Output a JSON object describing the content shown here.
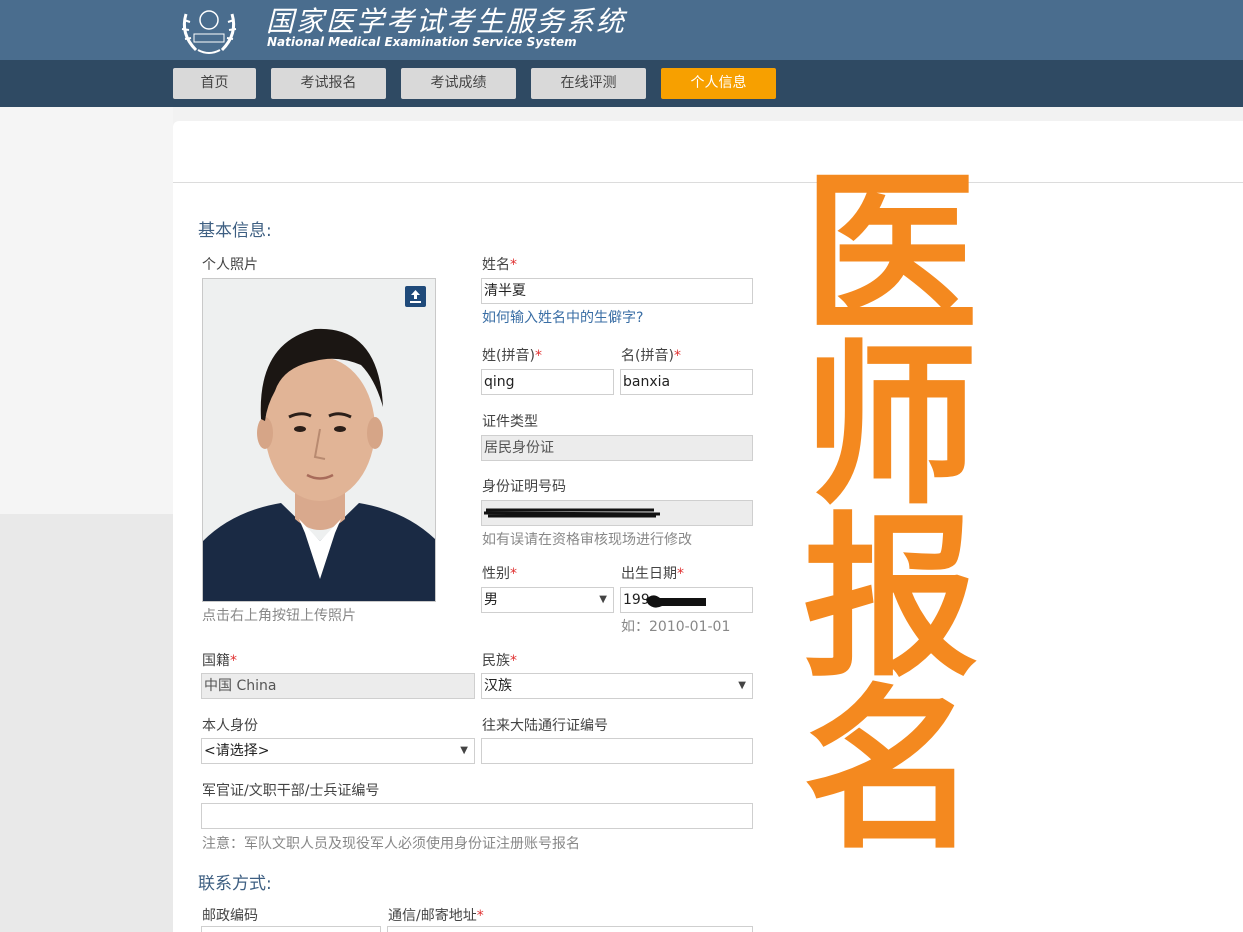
{
  "header": {
    "title_cn": "国家医学考试考生服务系统",
    "title_en": "National Medical Examination Service System"
  },
  "nav": {
    "tabs": [
      "首页",
      "考试报名",
      "考试成绩",
      "在线评测",
      "个人信息"
    ],
    "active_index": 4
  },
  "overlay_text": [
    "医",
    "师",
    "报",
    "名"
  ],
  "form": {
    "basic_section": "基本信息:",
    "photo_label": "个人照片",
    "photo_hint": "点击右上角按钮上传照片",
    "name_label": "姓名",
    "name_value": "清半夏",
    "name_help_link": "如何输入姓名中的生僻字?",
    "surname_pinyin_label": "姓(拼音)",
    "surname_pinyin_value": "qing",
    "given_pinyin_label": "名(拼音)",
    "given_pinyin_value": "banxia",
    "id_type_label": "证件类型",
    "id_type_value": "居民身份证",
    "id_number_label": "身份证明号码",
    "id_note": "如有误请在资格审核现场进行修改",
    "gender_label": "性别",
    "gender_value": "男",
    "birth_label": "出生日期",
    "birth_value": "199",
    "birth_example": "如：2010-01-01",
    "nationality_label": "国籍",
    "nationality_value": "中国 China",
    "ethnicity_label": "民族",
    "ethnicity_value": "汉族",
    "identity_label": "本人身份",
    "identity_value": "<请选择>",
    "permit_label": "往来大陆通行证编号",
    "permit_value": "",
    "military_label": "军官证/文职干部/士兵证编号",
    "military_value": "",
    "military_note": "注意：军队文职人员及现役军人必须使用身份证注册账号报名",
    "contact_section": "联系方式:",
    "postcode_label": "邮政编码",
    "address_label": "通信/邮寄地址"
  },
  "colors": {
    "header_bg": "#4a6d8e",
    "nav_bg": "#2f4a63",
    "active_tab": "#f7a000",
    "overlay": "#f4891f",
    "required": "#e03030"
  }
}
